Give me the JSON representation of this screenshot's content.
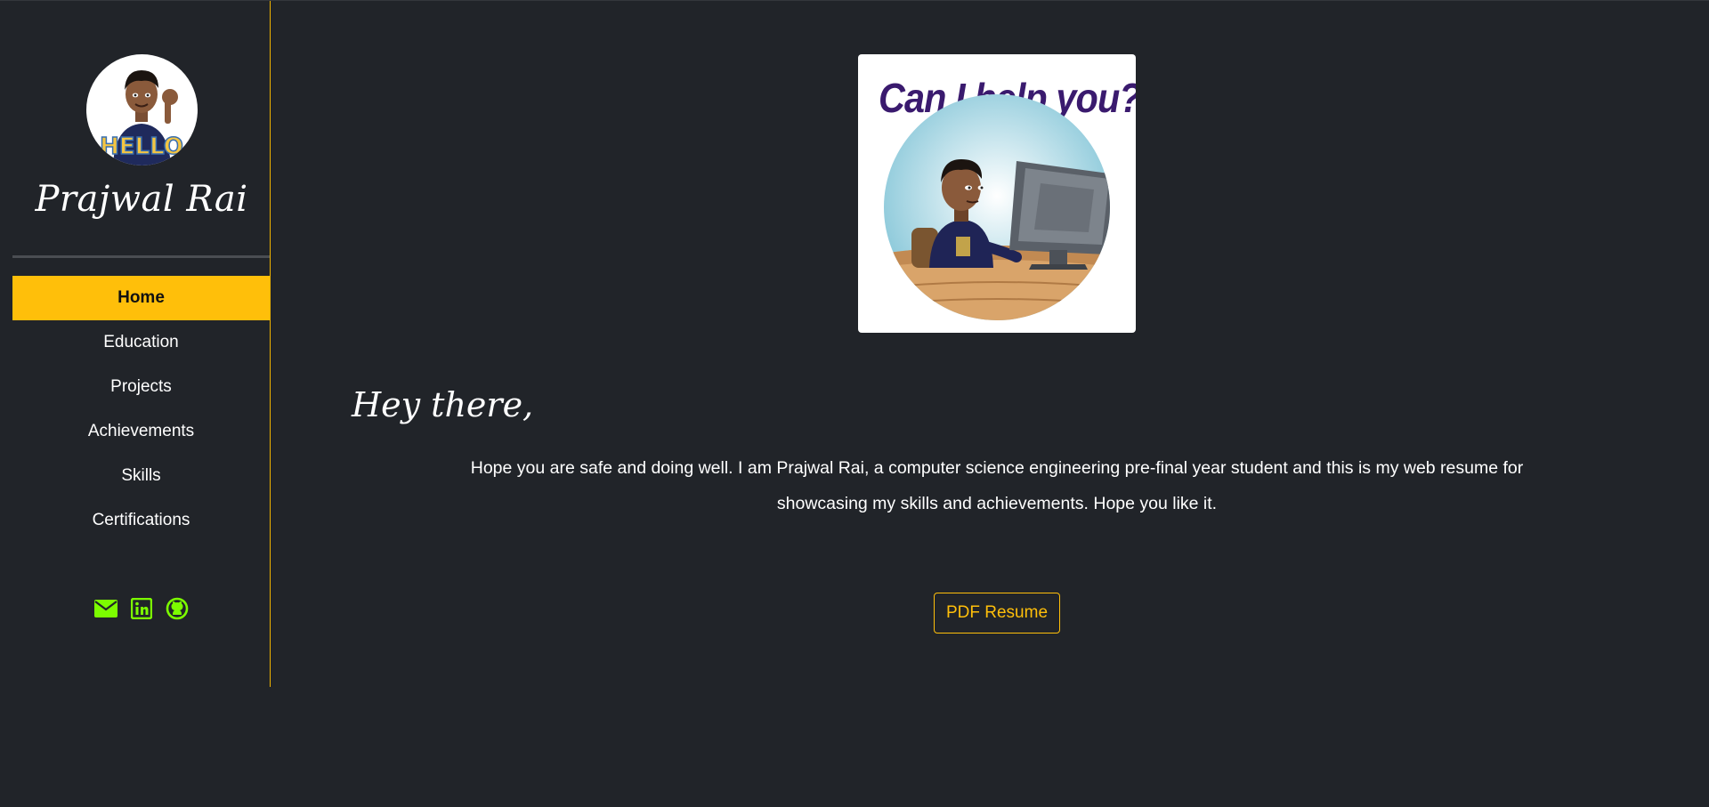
{
  "profile": {
    "name": "Prajwal Rai",
    "avatar_text": "HELLO"
  },
  "nav": {
    "items": [
      {
        "label": "Home",
        "active": true
      },
      {
        "label": "Education",
        "active": false
      },
      {
        "label": "Projects",
        "active": false
      },
      {
        "label": "Achievements",
        "active": false
      },
      {
        "label": "Skills",
        "active": false
      },
      {
        "label": "Certifications",
        "active": false
      }
    ]
  },
  "social": {
    "icons": [
      "envelope-icon",
      "linkedin-icon",
      "github-icon"
    ],
    "color": "#7cfc00"
  },
  "hero": {
    "caption": "Can I help you?"
  },
  "main": {
    "greeting": "Hey there,",
    "intro": "Hope you are safe and doing well. I am Prajwal Rai, a computer science engineering pre-final year student and this is my web resume for showcasing my skills and achievements. Hope you like it.",
    "resume_button": "PDF Resume"
  },
  "colors": {
    "background": "#212429",
    "accent": "#ffbf0a",
    "text": "#ffffff"
  }
}
